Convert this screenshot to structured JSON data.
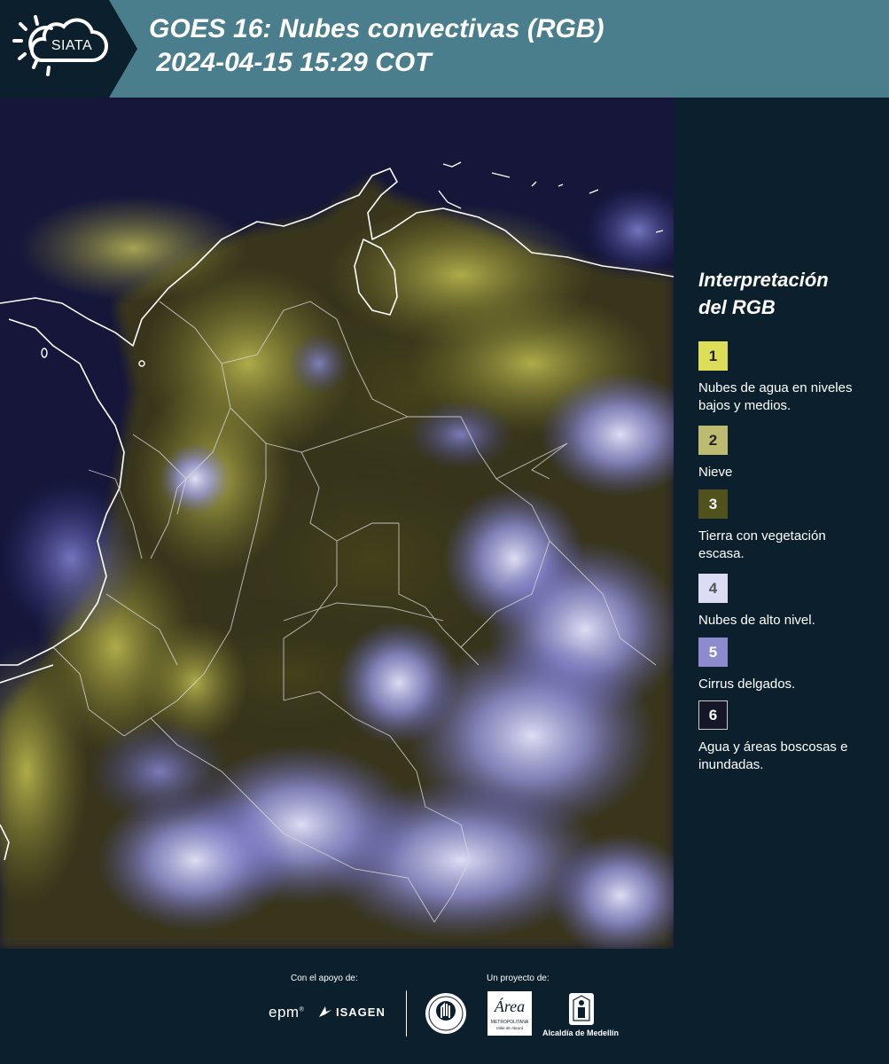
{
  "header": {
    "logo_text": "SIATA",
    "title_line1": "GOES 16: Nubes convectivas (RGB)",
    "title_line2": " 2024-04-15 15:29 COT"
  },
  "legend": {
    "title_line1": "Interpretación",
    "title_line2": "del RGB",
    "items": [
      {
        "number": "1",
        "color": "#dedd58",
        "label": "Nubes de agua en niveles bajos y medios."
      },
      {
        "number": "2",
        "color": "#bdbb71",
        "label": "Nieve"
      },
      {
        "number": "3",
        "color": "#50511c",
        "label": "Tierra con vegetación escasa."
      },
      {
        "number": "4",
        "color": "#dcdcf5",
        "label": "Nubes de alto nivel."
      },
      {
        "number": "5",
        "color": "#8b8bce",
        "label": "Cirrus delgados."
      },
      {
        "number": "6",
        "color": "#151628",
        "label": "Agua y áreas boscosas e inundadas."
      }
    ]
  },
  "footer": {
    "support_label": "Con el apoyo de:",
    "project_label": "Un proyecto de:",
    "sponsor_epm": "epm",
    "sponsor_isagen": "ISAGEN",
    "org_metropolitana": "METROPOLITANA",
    "org_valle": "Valle de Aburrá",
    "org_area_script": "Área",
    "org_alcaldia": "Alcaldía de Medellín"
  }
}
